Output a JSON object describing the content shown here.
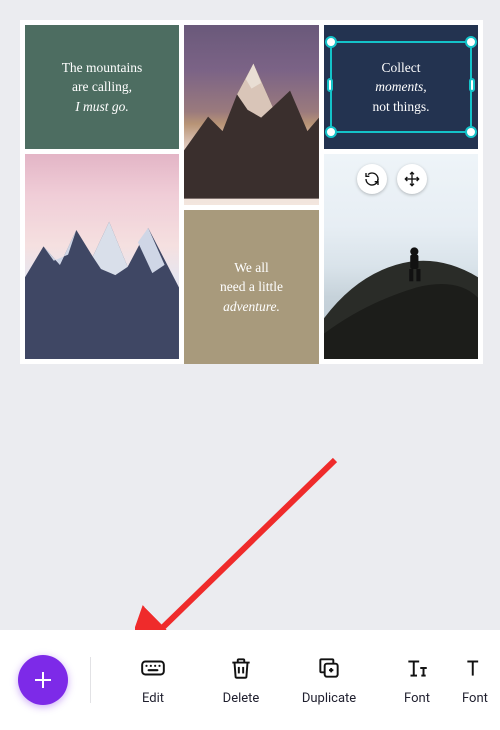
{
  "canvas": {
    "cards": {
      "mountains_text": {
        "line1": "The mountains",
        "line2": "are calling,",
        "line3": "I must go."
      },
      "adventure_text": {
        "line1": "We all",
        "line2": "need a little",
        "line3": "adventure."
      },
      "collect_text": {
        "line1": "Collect",
        "line2": "moments,",
        "line3": "not things."
      }
    },
    "selected": "collect_text"
  },
  "selection_tools": {
    "rotate": "rotate-icon",
    "move": "move-icon"
  },
  "toolbar": {
    "add_label": "+",
    "tools": [
      {
        "id": "edit",
        "label": "Edit",
        "icon": "keyboard-icon"
      },
      {
        "id": "delete",
        "label": "Delete",
        "icon": "trash-icon"
      },
      {
        "id": "duplicate",
        "label": "Duplicate",
        "icon": "duplicate-icon"
      },
      {
        "id": "font",
        "label": "Font",
        "icon": "font-icon"
      },
      {
        "id": "font2",
        "label": "Font",
        "icon": "font-icon"
      }
    ]
  },
  "colors": {
    "accent": "#7d2ae8",
    "selection": "#14c3c9",
    "arrow": "#ef2b2b"
  }
}
